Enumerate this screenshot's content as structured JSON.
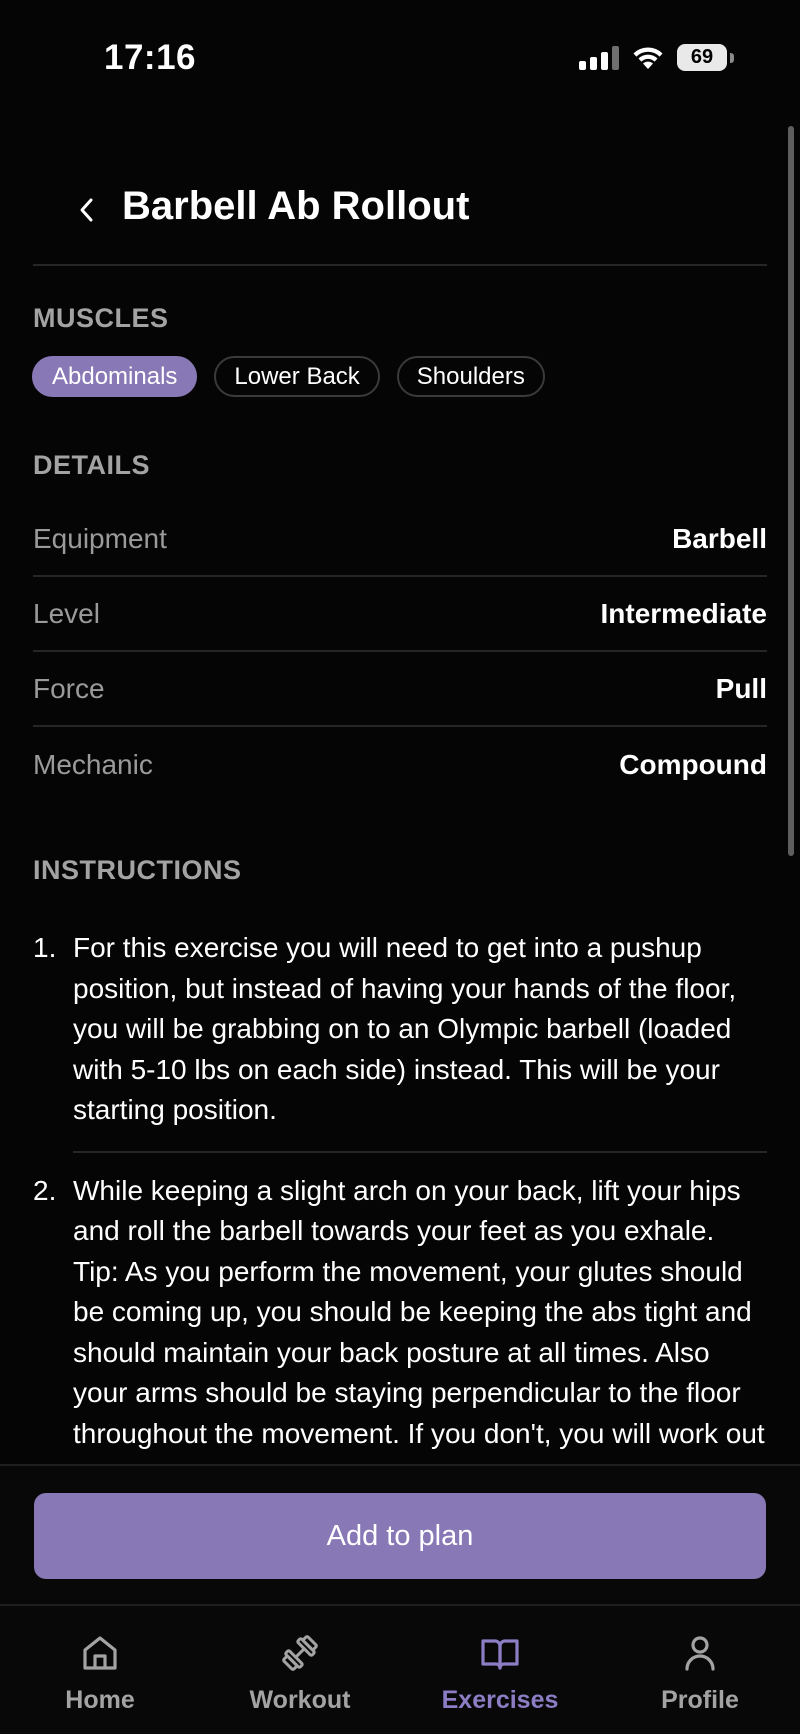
{
  "status_bar": {
    "time": "17:16",
    "battery": "69"
  },
  "header": {
    "title": "Barbell Ab Rollout"
  },
  "muscles": {
    "label": "MUSCLES",
    "chips": [
      {
        "label": "Abdominals",
        "active": true
      },
      {
        "label": "Lower Back",
        "active": false
      },
      {
        "label": "Shoulders",
        "active": false
      }
    ]
  },
  "details": {
    "label": "DETAILS",
    "rows": [
      {
        "key": "Equipment",
        "value": "Barbell"
      },
      {
        "key": "Level",
        "value": "Intermediate"
      },
      {
        "key": "Force",
        "value": "Pull"
      },
      {
        "key": "Mechanic",
        "value": "Compound"
      }
    ]
  },
  "instructions": {
    "label": "INSTRUCTIONS",
    "steps": [
      {
        "num": "1.",
        "text": "For this exercise you will need to get into a pushup position, but instead of having your hands of the floor, you will be grabbing on to an Olympic barbell (loaded with 5-10 lbs on each side) instead. This will be your starting position."
      },
      {
        "num": "2.",
        "text": "While keeping a slight arch on your back, lift your hips and roll the barbell towards your feet as you exhale. Tip: As you perform the movement, your glutes should be coming up, you should be keeping the abs tight and should maintain your back posture at all times. Also your arms should be staying perpendicular to the floor throughout the movement. If you don't, you will work out your"
      }
    ]
  },
  "action": {
    "add_label": "Add to plan"
  },
  "tabs": [
    {
      "label": "Home",
      "icon": "home-icon",
      "active": false
    },
    {
      "label": "Workout",
      "icon": "dumbbell-icon",
      "active": false
    },
    {
      "label": "Exercises",
      "icon": "book-icon",
      "active": true
    },
    {
      "label": "Profile",
      "icon": "person-icon",
      "active": false
    }
  ],
  "colors": {
    "accent": "#8878b5",
    "background": "#050505",
    "muted": "#a3a3a3"
  }
}
